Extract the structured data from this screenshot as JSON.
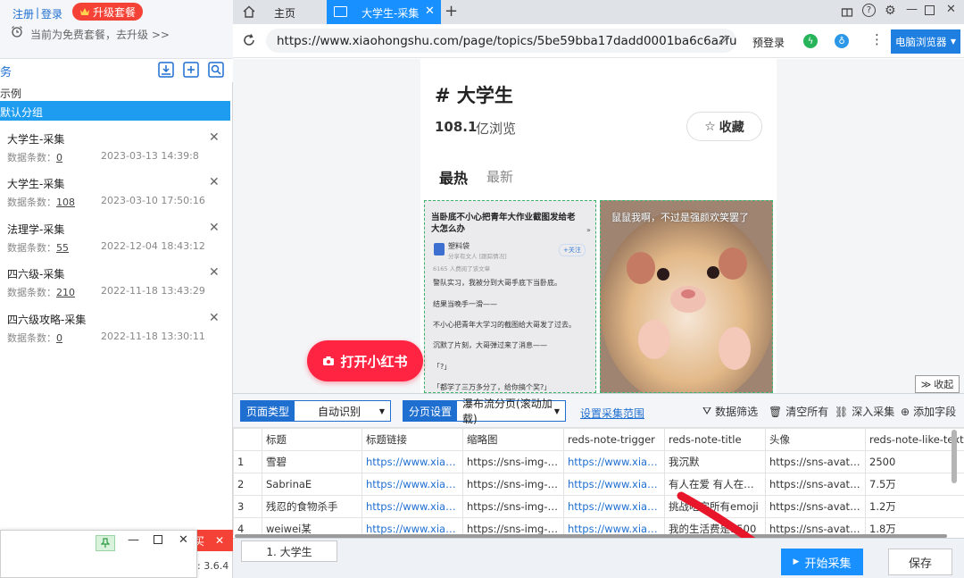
{
  "left": {
    "register": "注册",
    "login": "登录",
    "sep": "|",
    "upgrade": "升级套餐",
    "plan_notice": "当前为免费套餐，去升级 >>",
    "section_title": "务",
    "example": "示例",
    "default_group": "默认分组",
    "count_label": "数据条数：",
    "tasks": [
      {
        "title": "大学生-采集",
        "count": "0",
        "date": "2023-03-13 14:39:8"
      },
      {
        "title": "大学生-采集",
        "count": "108",
        "date": "2023-03-10 17:50:16"
      },
      {
        "title": "法理学-采集",
        "count": "55",
        "date": "2022-12-04 18:43:12"
      },
      {
        "title": "四六级-采集",
        "count": "210",
        "date": "2022-11-18 13:43:29"
      },
      {
        "title": "四六级攻略-采集",
        "count": "0",
        "date": "2022-11-18 13:30:11"
      }
    ],
    "red_tab_partial": "买",
    "version_partial": ": 3.6.4"
  },
  "browser": {
    "tabs": [
      {
        "label": "主页"
      },
      {
        "label": "大学生-采集"
      }
    ],
    "url": "https://www.xiaohongshu.com/page/topics/5be59bba17dadd0001ba6c6a?fu...",
    "prelogin": "预登录",
    "mode": "电脑浏览器"
  },
  "xhs": {
    "topic": "# 大学生",
    "views_num": "108.1",
    "views_unit": "亿浏览",
    "fav": "收藏",
    "tab_hot": "最热",
    "tab_new": "最新",
    "card1_title": "当卧底不小心把青年大作业截图发给老大怎么办",
    "card1_author": "塑料袋",
    "card1_sub": "分享有文人 [跟踪情况]",
    "card1_follow": "+关注",
    "card1_meta": "6165 人费阅了该文章",
    "card1_lines": [
      "警队实习，我被分到大哥手底下当卧底。",
      "结果当晚手一滑——",
      "不小心把青年大学习的截图给大哥发了过去。",
      "沉默了片刻，大哥弹过来了消息——",
      "「?」",
      "「都学了三万多分了，给你搞个奖?」"
    ],
    "card2_caption": "鼠鼠我啊，不过是强颜欢笑罢了",
    "open_app": "打开小红书",
    "collapse": "收起"
  },
  "collect": {
    "page_type_label": "页面类型",
    "page_type_value": "自动识别",
    "paging_label": "分页设置",
    "paging_value": "瀑布流分页(滚动加载)",
    "set_range": "设置采集范围",
    "filter": "数据筛选",
    "clear": "清空所有",
    "deep": "深入采集",
    "add_field": "添加字段",
    "columns": [
      "",
      "标题",
      "标题链接",
      "缩略图",
      "reds-note-trigger",
      "reds-note-title",
      "头像",
      "reds-note-like-text"
    ],
    "rows": [
      [
        "1",
        "雪碧",
        "https://www.xiaohon...",
        "https://sns-img-qn.x...",
        "https://www.xiaohon...",
        "我沉默",
        "https://sns-avatar-q...",
        "2500"
      ],
      [
        "2",
        "SabrinaE",
        "https://www.xiaohon...",
        "https://sns-img-qn.x...",
        "https://www.xiaohon...",
        "有人在爱 有人在图...",
        "https://sns-avatar-q...",
        "7.5万"
      ],
      [
        "3",
        "残忍的食物杀手",
        "https://www.xiaohon...",
        "https://sns-img-qn.x...",
        "https://www.xiaohon...",
        "挑战吃完所有emoji",
        "https://sns-avatar-q...",
        "1.2万"
      ],
      [
        "4",
        "weiwei某",
        "https://www.xiaohon...",
        "https://sns-img-qn.x...",
        "https://www.xiaohon...",
        "我的生活费是1500",
        "https://sns-avatar-q...",
        "1.8万"
      ]
    ],
    "bottom_tab": "1. 大学生",
    "start": "开始采集",
    "save": "保存"
  },
  "colors": {
    "accent": "#1890ff",
    "xhs_red": "#ff2442",
    "upgrade_red": "#f44336",
    "arrow_red": "#e8162b"
  }
}
